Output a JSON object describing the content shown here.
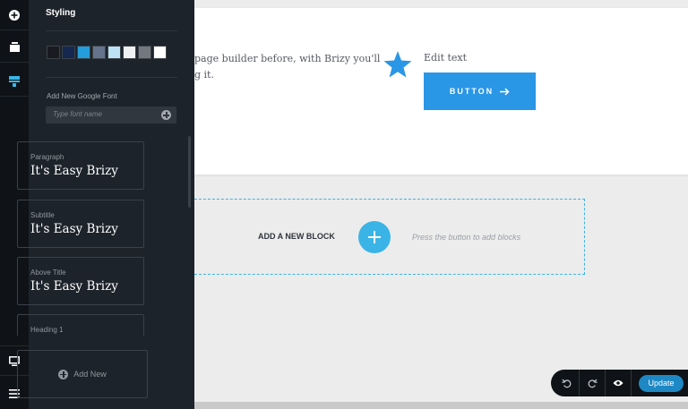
{
  "rail": {
    "icons": [
      "add-element-icon",
      "blocks-icon",
      "styling-icon",
      "device-icon",
      "menu-icon"
    ]
  },
  "panel": {
    "title": "Styling",
    "palette": [
      "#191b21",
      "#142850",
      "#239ddb",
      "#66738d",
      "#bde1f4",
      "#eef0f2",
      "#73777f",
      "#ffffff"
    ],
    "google_font": {
      "label": "Add New Google Font",
      "placeholder": "Type font name"
    },
    "fonts": [
      {
        "label": "Paragraph",
        "sample": "It's Easy Brizy"
      },
      {
        "label": "Subtitle",
        "sample": "It's Easy Brizy"
      },
      {
        "label": "Above Title",
        "sample": "It's Easy Brizy"
      },
      {
        "label": "Heading 1",
        "sample": ""
      }
    ],
    "add_new": "Add New"
  },
  "canvas": {
    "text_line_1": "page builder before, with Brizy you'll",
    "text_line_2": "g it.",
    "edit_text": "Edit text",
    "button_label": "BUTTON",
    "accent": "#2a96e6"
  },
  "new_block": {
    "label": "ADD A NEW BLOCK",
    "hint": "Press the button to add blocks"
  },
  "toolbar": {
    "update_label": "Update",
    "icons": [
      "undo-icon",
      "redo-icon",
      "preview-eye-icon"
    ]
  }
}
